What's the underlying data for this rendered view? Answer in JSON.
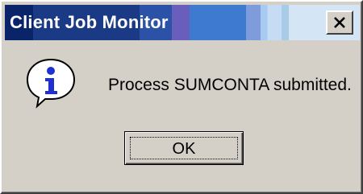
{
  "window": {
    "title": "Client Job Monitor",
    "close_icon": "close-icon"
  },
  "dialog": {
    "icon": "info-icon",
    "message": "Process SUMCONTA submitted.",
    "ok_label": "OK"
  }
}
